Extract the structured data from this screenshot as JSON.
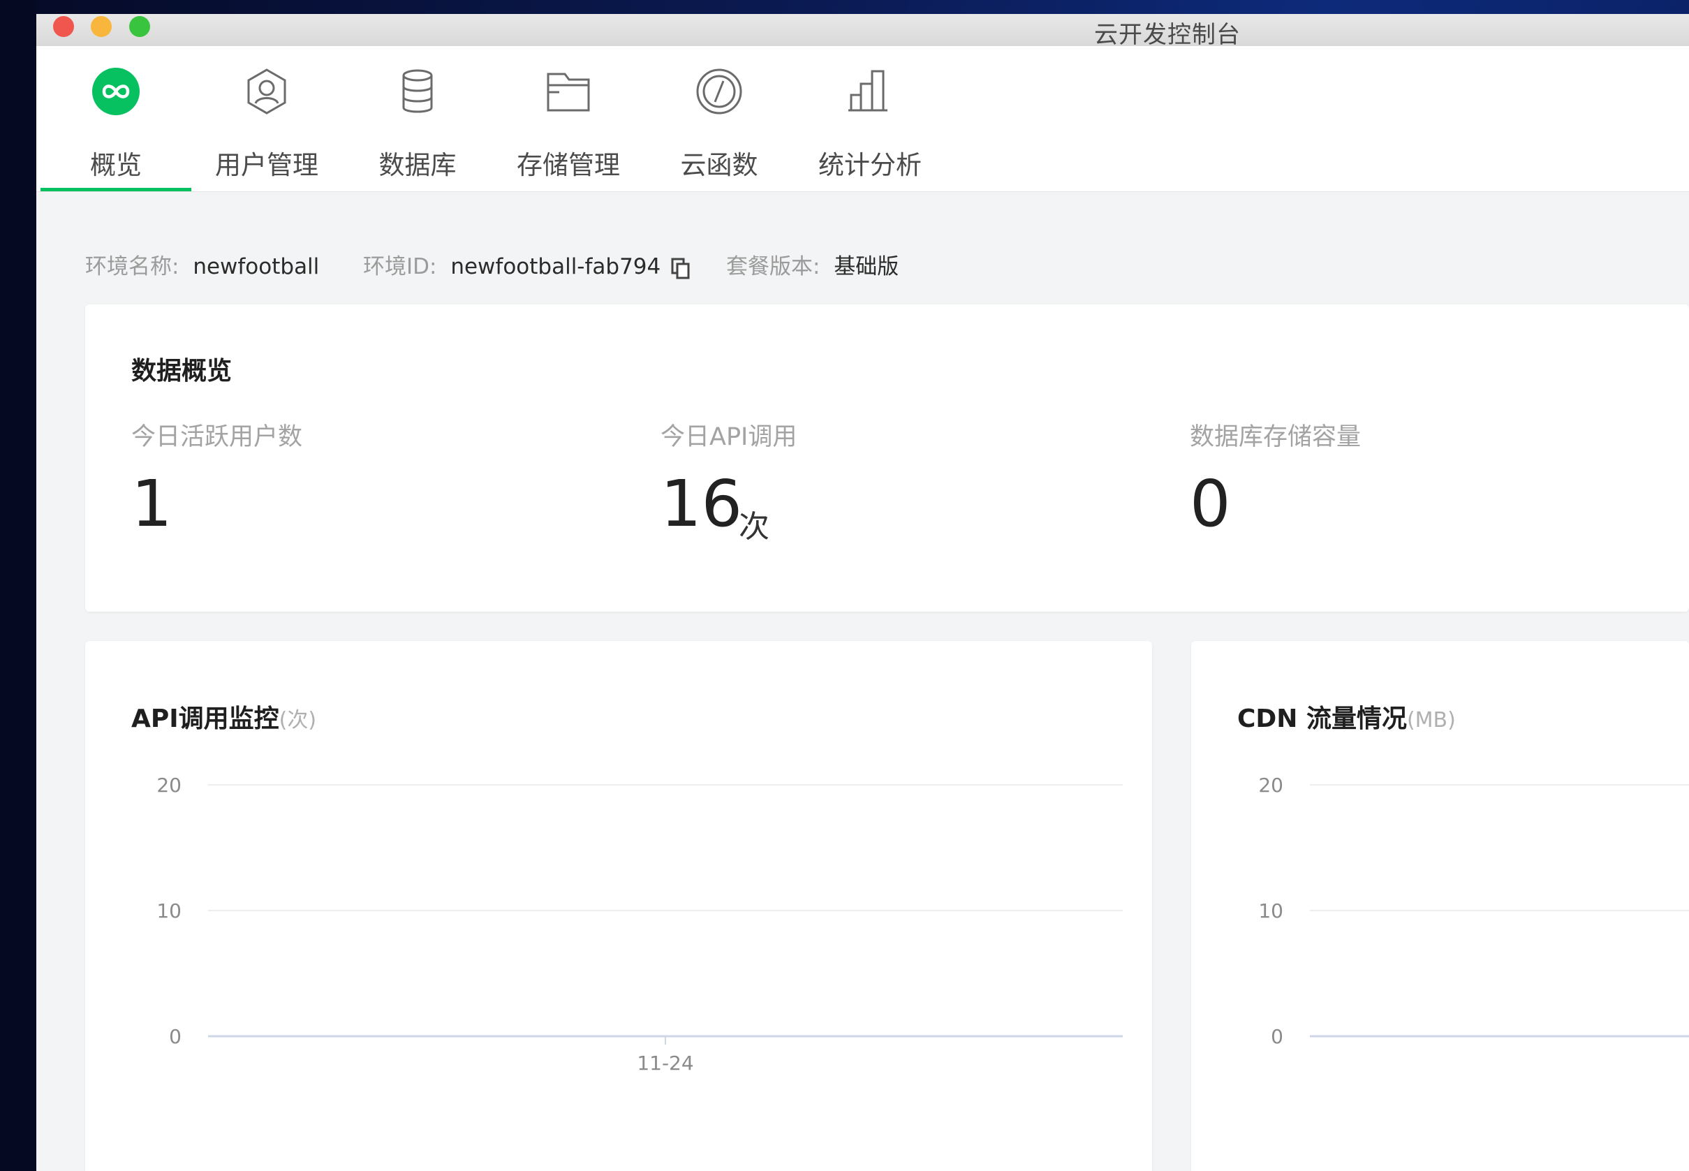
{
  "window": {
    "title": "云开发控制台"
  },
  "nav": {
    "items": [
      {
        "label": "概览",
        "icon": "overview-icon",
        "active": true
      },
      {
        "label": "用户管理",
        "icon": "user-icon",
        "active": false
      },
      {
        "label": "数据库",
        "icon": "database-icon",
        "active": false
      },
      {
        "label": "存储管理",
        "icon": "storage-icon",
        "active": false
      },
      {
        "label": "云函数",
        "icon": "cloud-function-icon",
        "active": false
      },
      {
        "label": "统计分析",
        "icon": "statistics-icon",
        "active": false
      }
    ],
    "accent_color": "#07c160"
  },
  "env": {
    "name_label": "环境名称:",
    "name_value": "newfootball",
    "id_label": "环境ID:",
    "id_value": "newfootball-fab794",
    "plan_label": "套餐版本:",
    "plan_value": "基础版"
  },
  "overview": {
    "title": "数据概览",
    "stats": [
      {
        "label": "今日活跃用户数",
        "value": "1",
        "unit": ""
      },
      {
        "label": "今日API调用",
        "value": "16",
        "unit": "次"
      },
      {
        "label": "数据库存储容量",
        "value": "0",
        "unit": ""
      }
    ]
  },
  "charts": {
    "api": {
      "title": "API调用监控",
      "unit": "(次)"
    },
    "cdn": {
      "title": "CDN 流量情况",
      "unit": "(MB)"
    }
  },
  "chart_data": [
    {
      "type": "line",
      "title": "API调用监控(次)",
      "y_ticks": [
        "20",
        "10",
        "0"
      ],
      "ylim": [
        0,
        20
      ],
      "x_ticks": [
        "11-24"
      ],
      "series": [],
      "grid": true
    },
    {
      "type": "line",
      "title": "CDN 流量情况(MB)",
      "y_ticks": [
        "20",
        "10",
        "0"
      ],
      "ylim": [
        0,
        20
      ],
      "x_ticks": [],
      "series": [],
      "grid": true
    }
  ]
}
